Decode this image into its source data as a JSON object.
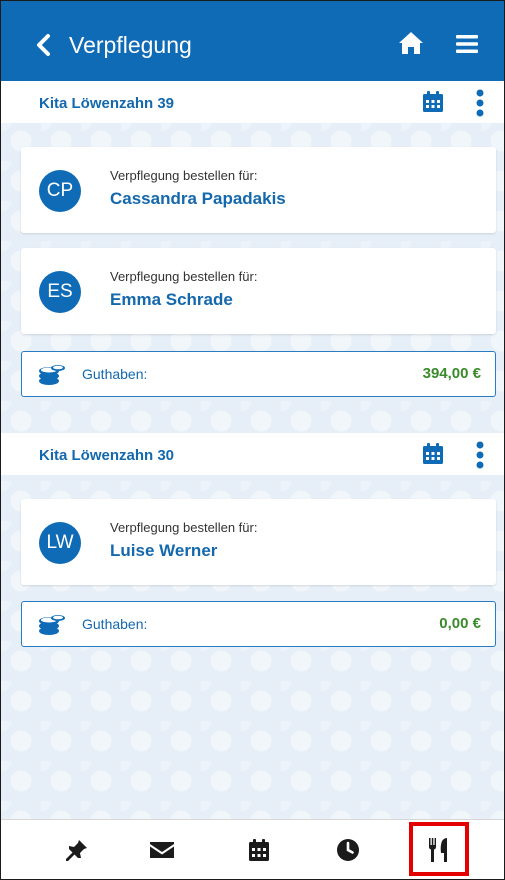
{
  "header": {
    "title": "Verpflegung",
    "back_icon": "chevron-left-icon",
    "home_icon": "home-icon",
    "menu_icon": "hamburger-menu-icon"
  },
  "groups": [
    {
      "kita": "Kita Löwenzahn 39",
      "children": [
        {
          "initials": "CP",
          "prompt": "Verpflegung bestellen für:",
          "name": "Cassandra Papadakis"
        },
        {
          "initials": "ES",
          "prompt": "Verpflegung bestellen für:",
          "name": "Emma Schrade"
        }
      ],
      "balance_label": "Guthaben:",
      "balance_amount": "394,00 €"
    },
    {
      "kita": "Kita Löwenzahn 30",
      "children": [
        {
          "initials": "LW",
          "prompt": "Verpflegung bestellen für:",
          "name": "Luise Werner"
        }
      ],
      "balance_label": "Guthaben:",
      "balance_amount": "0,00 €"
    }
  ],
  "bottom_nav": [
    {
      "icon": "pin-icon"
    },
    {
      "icon": "envelope-icon"
    },
    {
      "icon": "calendar-icon"
    },
    {
      "icon": "clock-icon"
    },
    {
      "icon": "fork-knife-icon",
      "active": true
    }
  ],
  "colors": {
    "primary": "#0f6bb5",
    "background": "#e6eff8",
    "balance_text": "#3b8a2b",
    "active_highlight": "#e50000"
  }
}
